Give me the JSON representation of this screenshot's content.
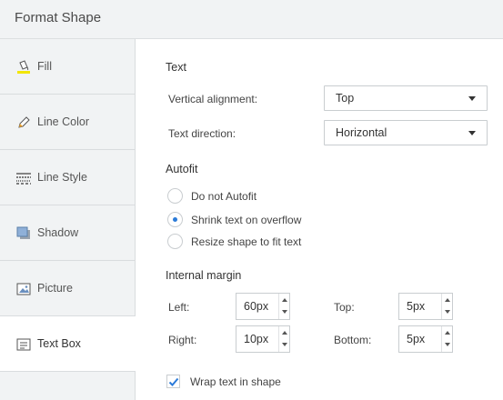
{
  "panel": {
    "title": "Format Shape"
  },
  "sidebar": {
    "items": [
      {
        "label": "Fill",
        "icon": "fill-bucket-icon"
      },
      {
        "label": "Line Color",
        "icon": "pencil-icon"
      },
      {
        "label": "Line Style",
        "icon": "line-style-icon"
      },
      {
        "label": "Shadow",
        "icon": "shadow-icon"
      },
      {
        "label": "Picture",
        "icon": "picture-icon"
      },
      {
        "label": "Text Box",
        "icon": "text-box-icon",
        "active": true
      }
    ]
  },
  "text_section": {
    "title": "Text",
    "vertical_alignment_label": "Vertical alignment:",
    "vertical_alignment_value": "Top",
    "text_direction_label": "Text direction:",
    "text_direction_value": "Horizontal"
  },
  "autofit": {
    "title": "Autofit",
    "options": [
      {
        "label": "Do not Autofit",
        "selected": false
      },
      {
        "label": "Shrink text on overflow",
        "selected": true
      },
      {
        "label": "Resize shape to fit text",
        "selected": false
      }
    ]
  },
  "internal_margin": {
    "title": "Internal margin",
    "left_label": "Left:",
    "left_value": "60px",
    "top_label": "Top:",
    "top_value": "5px",
    "right_label": "Right:",
    "right_value": "10px",
    "bottom_label": "Bottom:",
    "bottom_value": "5px"
  },
  "wrap": {
    "label": "Wrap text in shape",
    "checked": true
  },
  "colors": {
    "accent": "#2b7bd9",
    "fill_yellow": "#f2e600",
    "sidebar_bg": "#f1f3f4"
  }
}
